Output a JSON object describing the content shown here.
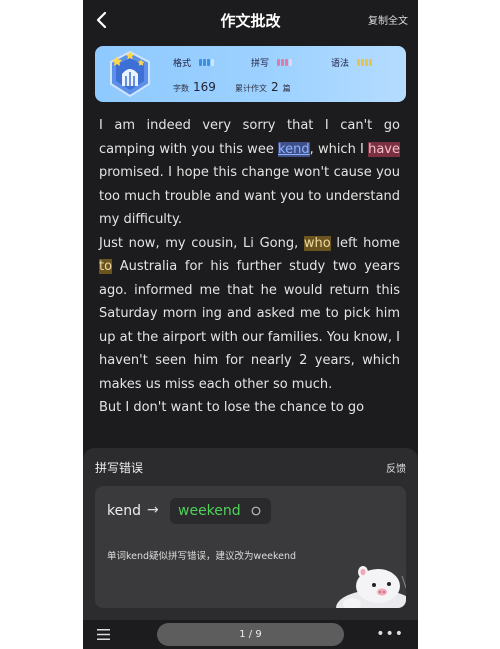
{
  "header": {
    "title": "作文批改",
    "copy_label": "复制全文"
  },
  "score_card": {
    "metrics": [
      {
        "label": "格式",
        "color": "#3d8fe0"
      },
      {
        "label": "拼写",
        "color": "#e07aa8"
      },
      {
        "label": "语法",
        "color": "#e8c34a"
      }
    ],
    "word_count_label": "字数",
    "word_count": "169",
    "total_label": "累计作文",
    "total_value": "2",
    "total_unit": "篇"
  },
  "essay": {
    "p1_a": "I am indeed very sorry that I can't go camping with you this wee ",
    "p1_err1": "kend",
    "p1_b": ", which I ",
    "p1_err2": "have",
    "p1_c": " promised. I hope this change won't cause you too much trouble and want you to understand my difficulty.",
    "p2_a": "Just now, my cousin, Li Gong, ",
    "p2_err1": "who",
    "p2_b": " left home ",
    "p2_err2": "to",
    "p2_c": " Australia for his further study two years ago. informed me that he would return this Saturday morn ing and asked me to pick him up at the airport with our families. You know, I haven't seen him for nearly 2 years, which makes us miss each other so much.",
    "p3": "But I don't want to lose the chance to go"
  },
  "panel": {
    "title": "拼写错误",
    "feedback_label": "反馈",
    "original": "kend",
    "suggestion": "weekend",
    "description": "单词kend疑似拼写错误，建议改为weekend"
  },
  "footer": {
    "pager": "1 / 9",
    "more": "•••"
  }
}
